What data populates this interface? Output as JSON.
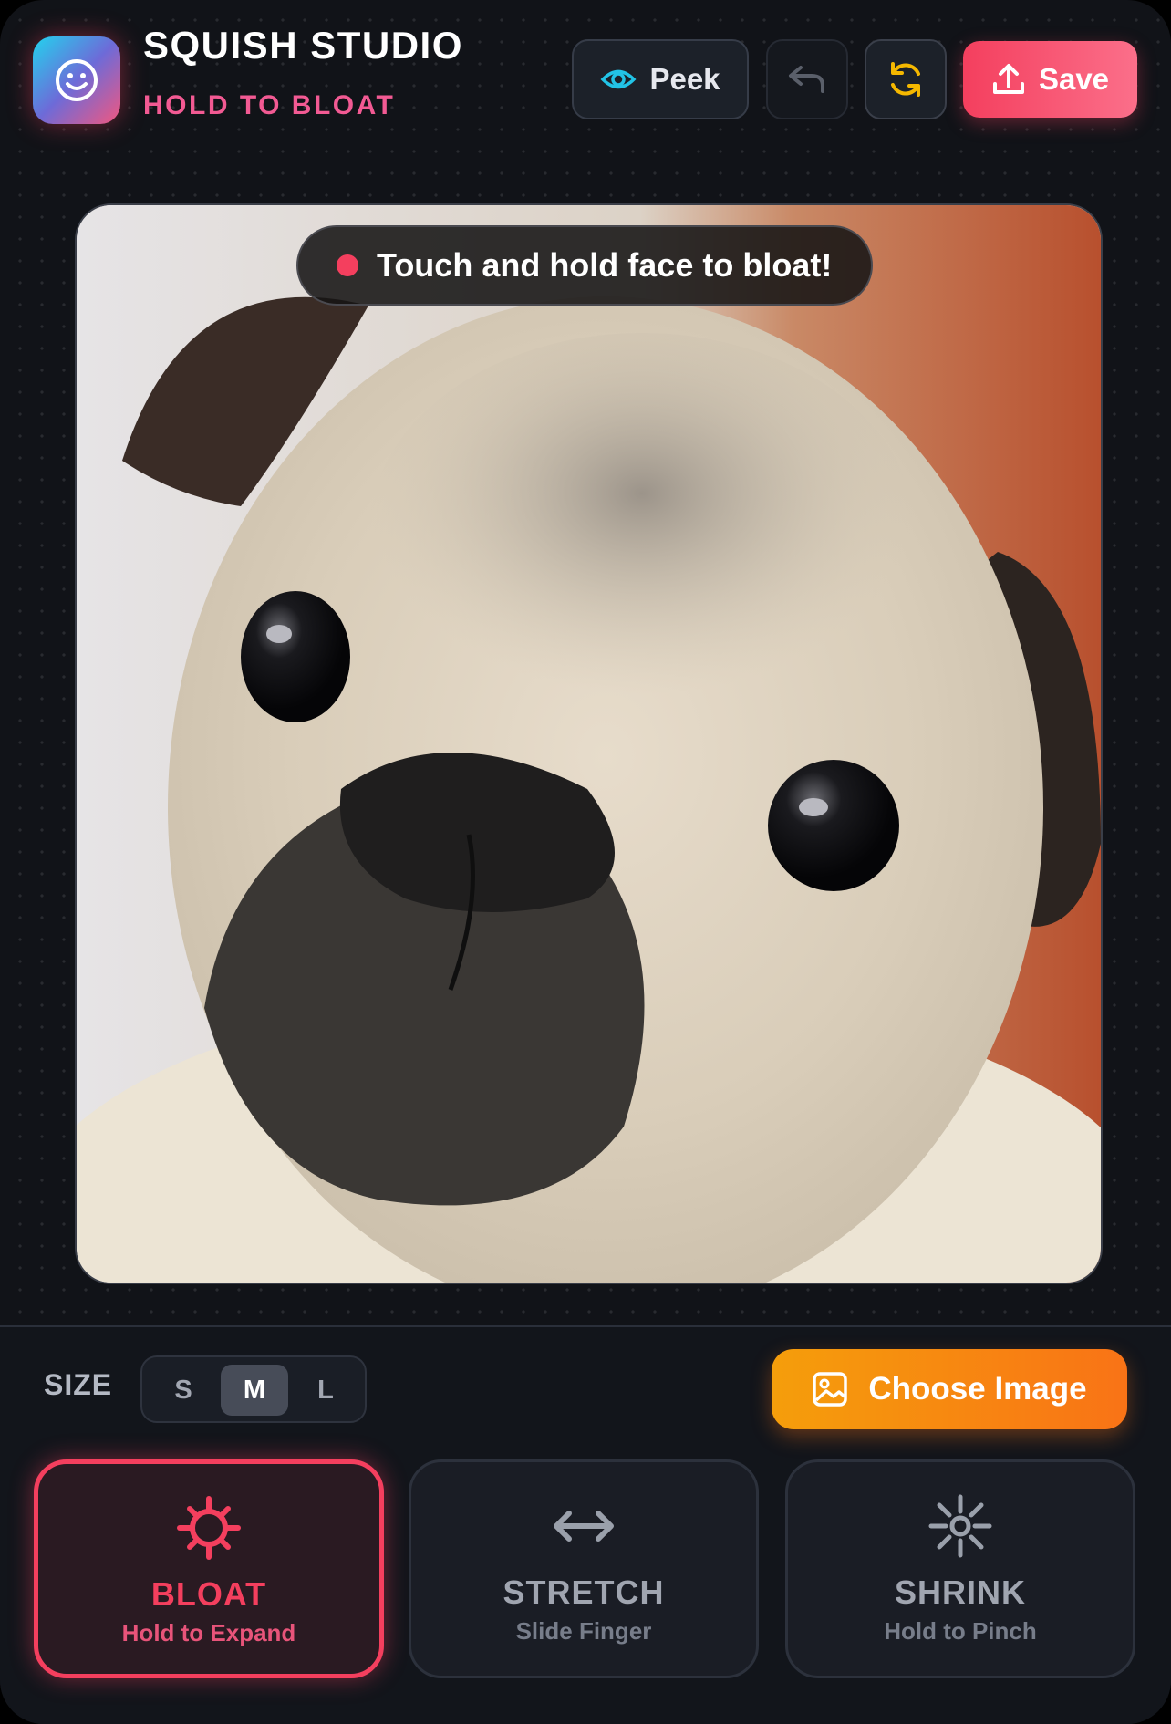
{
  "app": {
    "title": "SQUISH STUDIO",
    "subtitle": "HOLD TO BLOAT",
    "logo_icon": "smiley-face-icon"
  },
  "toolbar": {
    "peek_label": "Peek",
    "peek_icon": "eye-icon",
    "undo_icon": "undo-arrow-icon",
    "reset_icon": "refresh-icon",
    "save_label": "Save",
    "save_icon": "upload-icon"
  },
  "canvas": {
    "hint": "Touch and hold face to bloat!",
    "image_description_icon": "pug-photo"
  },
  "controls": {
    "size_label": "SIZE",
    "sizes": [
      "S",
      "M",
      "L"
    ],
    "selected_size": "M",
    "choose_image_label": "Choose Image",
    "choose_image_icon": "image-icon"
  },
  "modes": [
    {
      "title": "BLOAT",
      "subtitle": "Hold to Expand",
      "icon": "bloat-crosshair-icon",
      "active": true
    },
    {
      "title": "STRETCH",
      "subtitle": "Slide Finger",
      "icon": "horizontal-arrows-icon",
      "active": false
    },
    {
      "title": "SHRINK",
      "subtitle": "Hold to Pinch",
      "icon": "pinch-burst-icon",
      "active": false
    }
  ],
  "colors": {
    "accent": "#f43f5e",
    "subtitle": "#f25a93",
    "choose_image": "#f59e0b",
    "reset_icon": "#f5b800",
    "peek_icon": "#22c3e6"
  }
}
